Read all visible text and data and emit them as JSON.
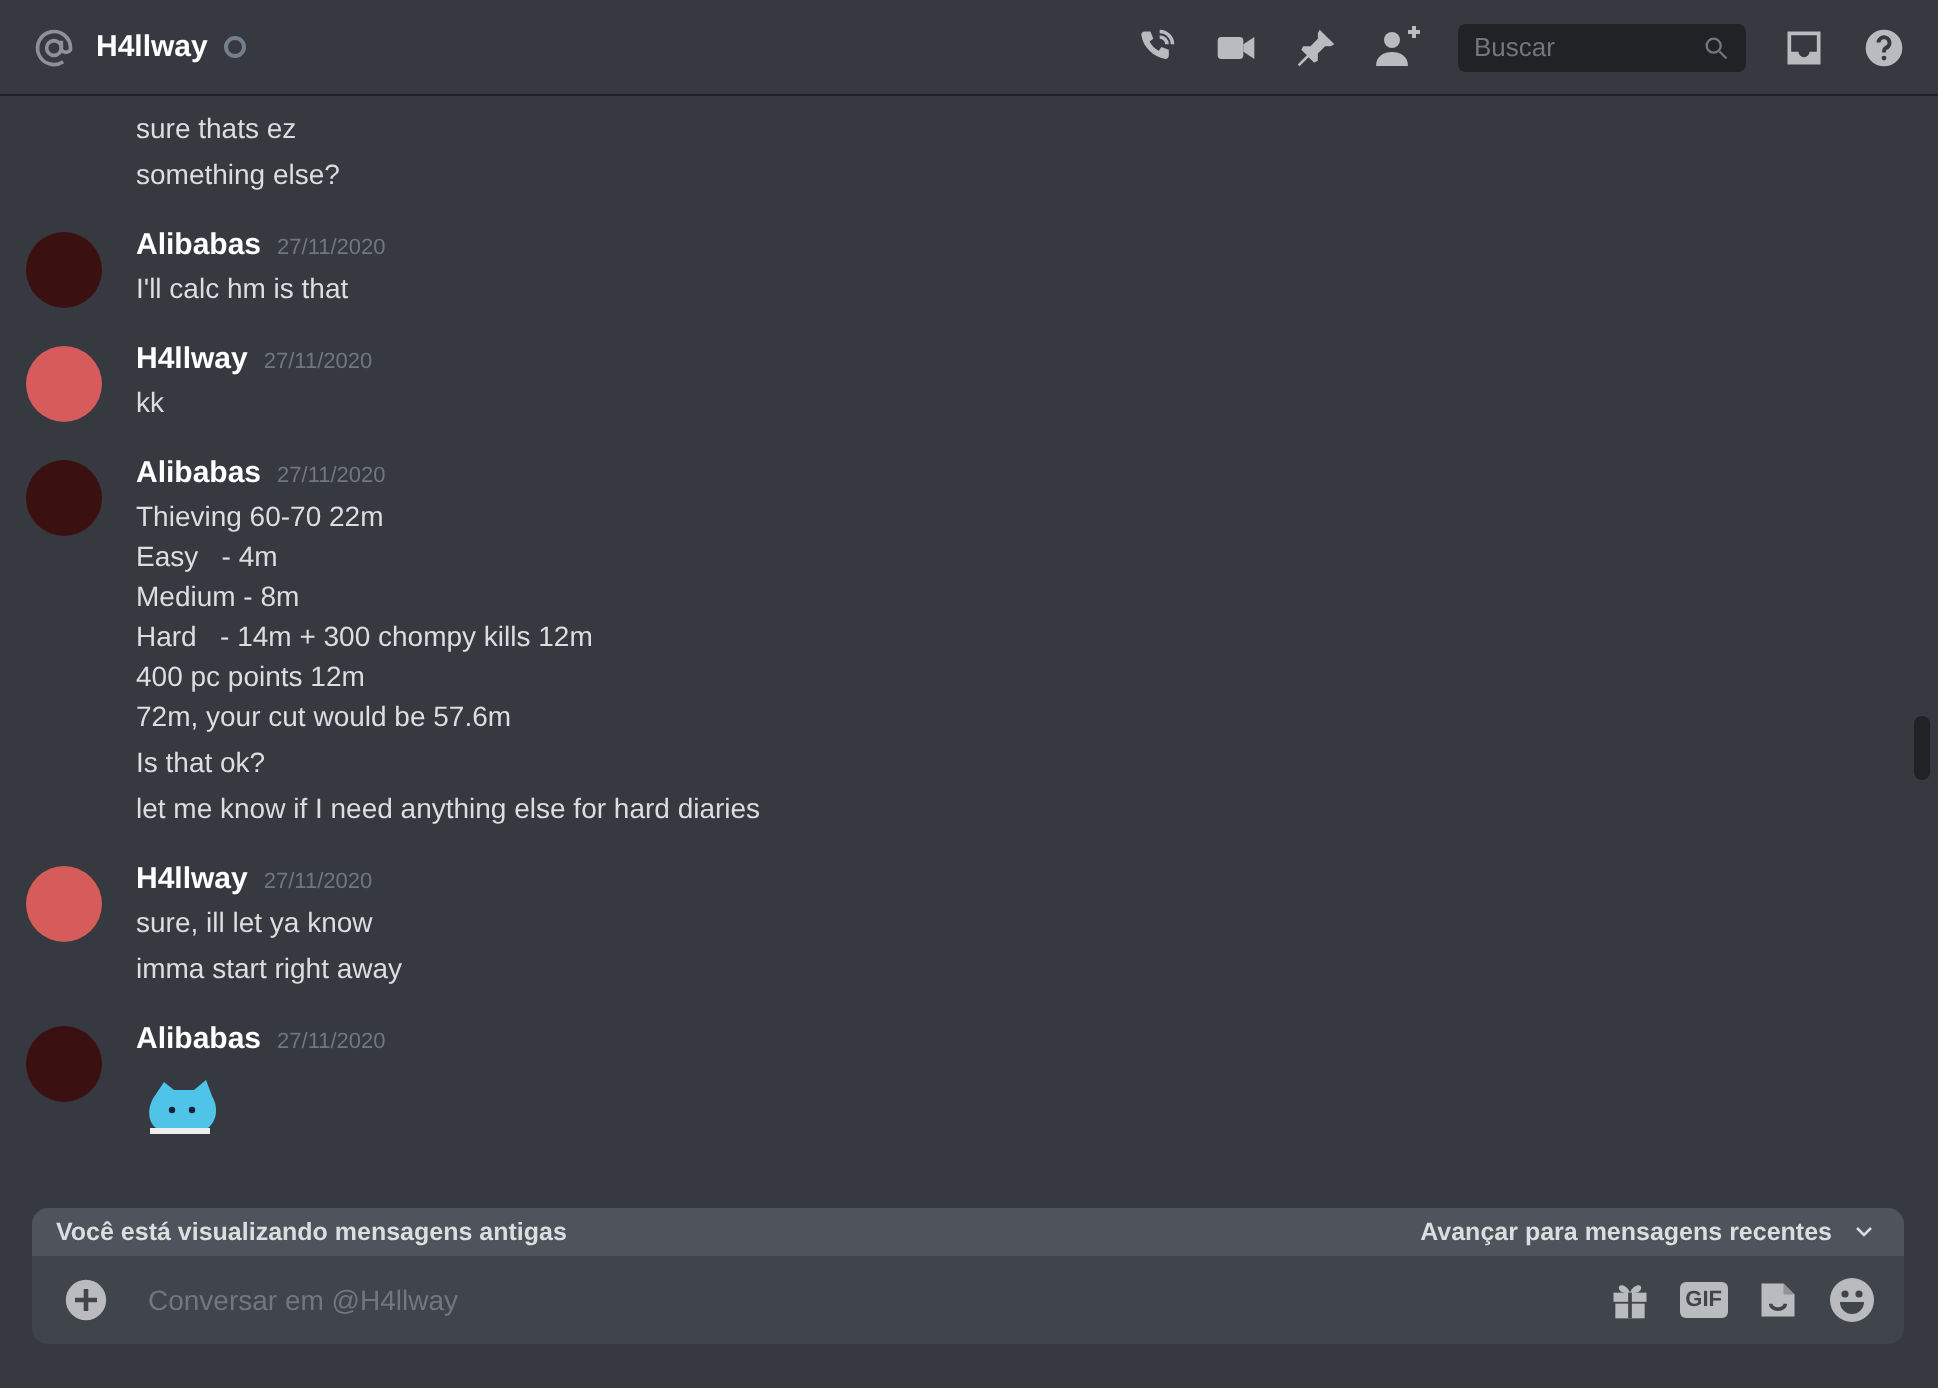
{
  "header": {
    "title": "H4llway",
    "search": {
      "placeholder": "Buscar"
    }
  },
  "groups": [
    {
      "messages": [
        {
          "kind": "text",
          "text": "sure thats ez"
        },
        {
          "kind": "text",
          "text": "something else?"
        }
      ]
    },
    {
      "author": "Alibabas",
      "date": "27/11/2020",
      "color": "#3a1010",
      "messages": [
        {
          "kind": "text",
          "text": "I'll calc hm is that"
        }
      ]
    },
    {
      "author": "H4llway",
      "date": "27/11/2020",
      "color": "#d65b5b",
      "messages": [
        {
          "kind": "text",
          "text": "kk"
        }
      ]
    },
    {
      "author": "Alibabas",
      "date": "27/11/2020",
      "color": "#3a1010",
      "messages": [
        {
          "kind": "text",
          "text": "Thieving 60-70 22m\nEasy   - 4m\nMedium - 8m\nHard   - 14m + 300 chompy kills 12m\n400 pc points 12m\n72m, your cut would be 57.6m"
        },
        {
          "kind": "text",
          "text": "Is that ok?"
        },
        {
          "kind": "text",
          "text": "let me know if I need anything else for hard diaries"
        }
      ]
    },
    {
      "author": "H4llway",
      "date": "27/11/2020",
      "color": "#d65b5b",
      "messages": [
        {
          "kind": "text",
          "text": "sure, ill let ya know"
        },
        {
          "kind": "text",
          "text": "imma start right away"
        }
      ]
    },
    {
      "author": "Alibabas",
      "date": "27/11/2020",
      "color": "#3a1010",
      "messages": [
        {
          "kind": "sticker"
        }
      ]
    }
  ],
  "jump_bar": {
    "notice": "Você está visualizando mensagens antigas",
    "action": "Avançar para mensagens recentes"
  },
  "composer": {
    "placeholder": "Conversar em @H4llway",
    "gif_label": "GIF"
  }
}
